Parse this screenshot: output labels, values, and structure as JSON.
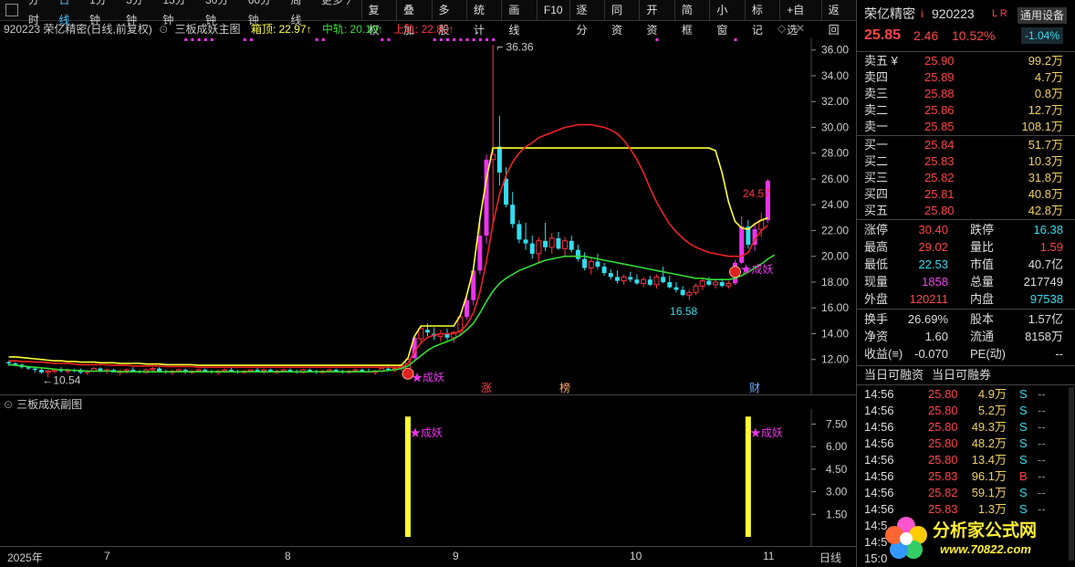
{
  "toolbar": {
    "periods": [
      "分时",
      "日线",
      "1分钟",
      "5分钟",
      "15分钟",
      "30分钟",
      "60分钟",
      "周线",
      "更多 〉"
    ],
    "active_period": "日线",
    "buttons": [
      "复权",
      "叠加",
      "多股",
      "统计",
      "画线",
      "F10",
      "逐分",
      "同资",
      "开资",
      "简框",
      "小窗",
      "标记",
      "+自选",
      "返回"
    ]
  },
  "header": {
    "code_name": "920223 荣亿精密(日线,前复权)",
    "indicator": "三板成妖主图",
    "top_label": "箱顶: 22.97↑",
    "mid_label": "中轨: 20.10↑",
    "up_label": "上轨: 22.80↑"
  },
  "chart_data": {
    "type": "candlestick",
    "title": "920223 荣亿精密(日线,前复权)",
    "y_ticks": [
      12.0,
      14.0,
      16.0,
      18.0,
      20.0,
      22.0,
      24.0,
      26.0,
      28.0,
      30.0,
      32.0,
      34.0,
      36.0
    ],
    "ylim": [
      10.0,
      36.9
    ],
    "x_labels": [
      "2025年",
      "7",
      "8",
      "9",
      "10",
      "11",
      "日线"
    ],
    "annotations": {
      "high": "36.36",
      "low_left": "←10.54",
      "low_mid": "16.58",
      "recent": "24.57",
      "signal": "★成妖"
    },
    "markers": [
      "涨",
      "榜",
      "财"
    ],
    "candles": [
      [
        11.8,
        11.9,
        11.5,
        11.7
      ],
      [
        11.7,
        11.8,
        11.5,
        11.6
      ],
      [
        11.6,
        11.7,
        11.3,
        11.4
      ],
      [
        11.4,
        11.5,
        11.2,
        11.3
      ],
      [
        11.3,
        11.4,
        11.0,
        11.2
      ],
      [
        11.2,
        11.3,
        10.9,
        11.0
      ],
      [
        11.0,
        11.2,
        10.6,
        11.1
      ],
      [
        11.1,
        11.3,
        10.9,
        11.2
      ],
      [
        11.2,
        11.4,
        11.0,
        11.1
      ],
      [
        11.1,
        11.3,
        10.9,
        11.2
      ],
      [
        11.2,
        11.3,
        11.0,
        11.1
      ],
      [
        11.1,
        11.3,
        10.9,
        11.0
      ],
      [
        11.0,
        11.2,
        10.8,
        11.1
      ],
      [
        11.1,
        11.4,
        11.0,
        11.3
      ],
      [
        11.3,
        11.4,
        11.0,
        11.1
      ],
      [
        11.1,
        11.3,
        10.9,
        11.2
      ],
      [
        11.2,
        11.3,
        11.0,
        11.0
      ],
      [
        11.0,
        11.2,
        10.8,
        11.1
      ],
      [
        11.1,
        11.3,
        10.9,
        11.2
      ],
      [
        11.2,
        11.4,
        11.0,
        11.1
      ],
      [
        11.1,
        11.2,
        10.9,
        11.0
      ],
      [
        11.0,
        11.3,
        10.9,
        11.2
      ],
      [
        11.2,
        11.4,
        11.0,
        11.3
      ],
      [
        11.3,
        11.4,
        11.1,
        11.1
      ],
      [
        11.1,
        11.2,
        10.9,
        11.0
      ],
      [
        11.0,
        11.2,
        10.8,
        11.1
      ],
      [
        11.1,
        11.3,
        11.0,
        11.2
      ],
      [
        11.2,
        11.3,
        10.9,
        11.0
      ],
      [
        11.0,
        11.2,
        10.9,
        11.1
      ],
      [
        11.1,
        11.3,
        11.0,
        11.2
      ],
      [
        11.2,
        11.3,
        11.0,
        11.1
      ],
      [
        11.1,
        11.2,
        10.9,
        11.0
      ],
      [
        11.0,
        11.2,
        10.8,
        11.1
      ],
      [
        11.1,
        11.3,
        11.0,
        11.2
      ],
      [
        11.2,
        11.4,
        11.0,
        11.1
      ],
      [
        11.1,
        11.2,
        10.9,
        11.0
      ],
      [
        11.0,
        11.2,
        10.9,
        11.1
      ],
      [
        11.1,
        11.2,
        11.0,
        11.2
      ],
      [
        11.2,
        11.4,
        11.0,
        11.1
      ],
      [
        11.1,
        11.3,
        10.9,
        11.2
      ],
      [
        11.2,
        11.3,
        11.0,
        11.0
      ],
      [
        11.0,
        11.2,
        10.9,
        11.1
      ],
      [
        11.1,
        11.3,
        11.0,
        11.2
      ],
      [
        11.2,
        11.3,
        11.0,
        11.1
      ],
      [
        11.1,
        11.2,
        10.9,
        11.0
      ],
      [
        11.0,
        11.3,
        10.9,
        11.2
      ],
      [
        11.2,
        11.3,
        11.0,
        11.1
      ],
      [
        11.1,
        11.2,
        10.9,
        11.0
      ],
      [
        11.0,
        11.2,
        10.9,
        11.1
      ],
      [
        11.1,
        11.3,
        11.0,
        11.2
      ],
      [
        11.2,
        11.3,
        11.0,
        11.1
      ],
      [
        11.1,
        11.2,
        10.9,
        11.0
      ],
      [
        11.0,
        11.2,
        10.9,
        11.1
      ],
      [
        11.1,
        11.3,
        11.0,
        11.2
      ],
      [
        11.2,
        11.3,
        11.0,
        11.1
      ],
      [
        11.1,
        11.3,
        11.0,
        11.0
      ],
      [
        11.0,
        11.2,
        10.8,
        11.1
      ],
      [
        11.1,
        11.3,
        11.0,
        11.3
      ],
      [
        11.3,
        11.5,
        11.1,
        11.2
      ],
      [
        11.2,
        11.4,
        11.0,
        11.3
      ],
      [
        11.3,
        11.6,
        11.1,
        11.5
      ],
      [
        11.0,
        12.2,
        10.9,
        12.0
      ],
      [
        12.1,
        13.8,
        12.0,
        13.7
      ],
      [
        13.6,
        14.6,
        13.3,
        14.4
      ],
      [
        14.3,
        14.8,
        13.8,
        14.1
      ],
      [
        14.0,
        14.5,
        13.5,
        13.8
      ],
      [
        13.8,
        14.3,
        13.4,
        14.0
      ],
      [
        14.0,
        14.4,
        13.5,
        13.7
      ],
      [
        13.7,
        14.2,
        13.3,
        14.1
      ],
      [
        14.2,
        15.4,
        14.0,
        15.3
      ],
      [
        15.3,
        17.0,
        15.1,
        16.6
      ],
      [
        16.6,
        19.0,
        16.2,
        18.9
      ],
      [
        18.9,
        22.9,
        18.6,
        21.6
      ],
      [
        21.6,
        27.9,
        21.0,
        27.5
      ],
      [
        27.5,
        36.4,
        22.5,
        27.9
      ],
      [
        28.5,
        30.9,
        25.5,
        26.5
      ],
      [
        26.0,
        26.9,
        23.8,
        24.0
      ],
      [
        24.0,
        25.0,
        22.2,
        22.5
      ],
      [
        22.5,
        22.8,
        21.0,
        21.3
      ],
      [
        21.3,
        22.6,
        20.5,
        21.0
      ],
      [
        21.0,
        21.6,
        19.8,
        20.2
      ],
      [
        20.2,
        21.5,
        19.5,
        21.2
      ],
      [
        21.2,
        22.6,
        20.4,
        20.7
      ],
      [
        20.7,
        21.8,
        20.2,
        21.4
      ],
      [
        21.4,
        21.9,
        20.5,
        20.6
      ],
      [
        20.6,
        21.5,
        20.0,
        21.2
      ],
      [
        21.2,
        21.6,
        20.3,
        20.5
      ],
      [
        20.5,
        20.9,
        19.6,
        19.8
      ],
      [
        19.8,
        20.3,
        18.9,
        19.1
      ],
      [
        19.1,
        19.9,
        18.6,
        19.6
      ],
      [
        19.6,
        20.2,
        19.0,
        19.2
      ],
      [
        19.2,
        19.5,
        18.5,
        18.7
      ],
      [
        18.7,
        19.0,
        18.2,
        18.4
      ],
      [
        18.4,
        18.9,
        17.9,
        18.1
      ],
      [
        18.1,
        18.6,
        17.8,
        18.4
      ],
      [
        18.4,
        18.8,
        18.0,
        18.2
      ],
      [
        18.2,
        18.6,
        17.8,
        17.9
      ],
      [
        17.9,
        18.4,
        17.6,
        18.2
      ],
      [
        18.2,
        18.5,
        17.7,
        17.8
      ],
      [
        17.8,
        18.6,
        17.5,
        18.4
      ],
      [
        18.4,
        19.2,
        17.9,
        18.0
      ],
      [
        18.0,
        18.5,
        17.5,
        17.6
      ],
      [
        17.6,
        18.0,
        17.2,
        17.4
      ],
      [
        17.4,
        17.7,
        16.9,
        17.0
      ],
      [
        17.0,
        17.4,
        16.6,
        17.2
      ],
      [
        17.2,
        17.9,
        17.0,
        17.7
      ],
      [
        17.7,
        18.3,
        17.4,
        18.1
      ],
      [
        18.1,
        18.4,
        17.7,
        17.8
      ],
      [
        17.8,
        18.2,
        17.5,
        18.0
      ],
      [
        18.0,
        18.3,
        17.6,
        17.7
      ],
      [
        17.7,
        18.1,
        17.5,
        17.9
      ],
      [
        17.9,
        19.7,
        17.8,
        19.5
      ],
      [
        19.5,
        23.1,
        19.4,
        22.3
      ],
      [
        22.3,
        22.8,
        20.6,
        20.9
      ],
      [
        20.9,
        22.6,
        20.4,
        22.1
      ],
      [
        22.1,
        23.4,
        21.5,
        22.8
      ],
      [
        22.8,
        26.0,
        22.6,
        25.85
      ]
    ],
    "ma_yellow": [
      12.2,
      12.2,
      12.15,
      12.1,
      12.05,
      12.0,
      11.95,
      11.9,
      11.9,
      11.85,
      11.85,
      11.8,
      11.8,
      11.8,
      11.75,
      11.75,
      11.75,
      11.7,
      11.7,
      11.7,
      11.7,
      11.65,
      11.65,
      11.65,
      11.6,
      11.6,
      11.6,
      11.6,
      11.6,
      11.55,
      11.55,
      11.55,
      11.55,
      11.55,
      11.55,
      11.55,
      11.55,
      11.55,
      11.55,
      11.55,
      11.55,
      11.55,
      11.55,
      11.55,
      11.55,
      11.55,
      11.55,
      11.55,
      11.55,
      11.55,
      11.55,
      11.55,
      11.55,
      11.55,
      11.55,
      11.55,
      11.55,
      11.55,
      11.55,
      11.55,
      11.55,
      12.1,
      13.8,
      14.6,
      14.6,
      14.6,
      14.6,
      14.6,
      14.6,
      15.4,
      17.0,
      19.0,
      22.9,
      26.0,
      28.4,
      28.4,
      28.4,
      28.4,
      28.4,
      28.4,
      28.4,
      28.4,
      28.4,
      28.4,
      28.4,
      28.4,
      28.4,
      28.4,
      28.4,
      28.4,
      28.4,
      28.4,
      28.4,
      28.4,
      28.4,
      28.4,
      28.4,
      28.4,
      28.4,
      28.4,
      28.4,
      28.4,
      28.4,
      28.4,
      28.4,
      28.4,
      28.4,
      28.4,
      28.2,
      26.5,
      24.2,
      22.7,
      22.2,
      22.1,
      22.5,
      22.8,
      23.0
    ],
    "ma_red": [
      11.9,
      11.9,
      11.85,
      11.85,
      11.8,
      11.8,
      11.75,
      11.7,
      11.7,
      11.7,
      11.65,
      11.6,
      11.6,
      11.6,
      11.6,
      11.6,
      11.55,
      11.55,
      11.55,
      11.5,
      11.5,
      11.5,
      11.5,
      11.5,
      11.45,
      11.45,
      11.45,
      11.45,
      11.45,
      11.4,
      11.4,
      11.4,
      11.4,
      11.4,
      11.4,
      11.4,
      11.4,
      11.4,
      11.4,
      11.4,
      11.4,
      11.4,
      11.4,
      11.4,
      11.4,
      11.4,
      11.4,
      11.4,
      11.4,
      11.4,
      11.4,
      11.4,
      11.4,
      11.4,
      11.4,
      11.4,
      11.4,
      11.4,
      11.4,
      11.4,
      11.4,
      11.7,
      12.6,
      13.3,
      13.7,
      13.9,
      14.0,
      14.0,
      14.0,
      14.2,
      14.7,
      15.6,
      17.2,
      19.6,
      22.5,
      24.8,
      26.3,
      27.3,
      28.0,
      28.5,
      28.8,
      29.2,
      29.4,
      29.6,
      29.8,
      30.0,
      30.1,
      30.2,
      30.2,
      30.2,
      30.1,
      30.0,
      29.8,
      29.5,
      29.0,
      28.3,
      27.5,
      26.5,
      25.3,
      24.2,
      23.3,
      22.5,
      21.9,
      21.4,
      21.0,
      20.7,
      20.5,
      20.3,
      20.2,
      20.1,
      20.0,
      20.0,
      20.0,
      20.3,
      21.3,
      22.0,
      22.4
    ],
    "ma_green": [
      11.6,
      11.55,
      11.5,
      11.45,
      11.4,
      11.35,
      11.3,
      11.25,
      11.2,
      11.2,
      11.15,
      11.15,
      11.1,
      11.1,
      11.1,
      11.1,
      11.1,
      11.05,
      11.05,
      11.05,
      11.05,
      11.05,
      11.05,
      11.05,
      11.05,
      11.05,
      11.05,
      11.05,
      11.05,
      11.05,
      11.05,
      11.05,
      11.05,
      11.05,
      11.05,
      11.05,
      11.05,
      11.05,
      11.05,
      11.05,
      11.05,
      11.05,
      11.05,
      11.05,
      11.05,
      11.05,
      11.05,
      11.05,
      11.05,
      11.05,
      11.05,
      11.05,
      11.05,
      11.05,
      11.05,
      11.05,
      11.1,
      11.1,
      11.15,
      11.2,
      11.3,
      11.5,
      11.9,
      12.3,
      12.7,
      13.0,
      13.2,
      13.4,
      13.6,
      13.9,
      14.3,
      14.8,
      15.6,
      16.5,
      17.3,
      17.9,
      18.3,
      18.6,
      18.9,
      19.1,
      19.3,
      19.5,
      19.7,
      19.8,
      19.9,
      20.0,
      20.0,
      20.0,
      20.0,
      19.9,
      19.8,
      19.7,
      19.6,
      19.5,
      19.4,
      19.3,
      19.2,
      19.1,
      19.0,
      18.9,
      18.8,
      18.7,
      18.6,
      18.5,
      18.4,
      18.3,
      18.3,
      18.2,
      18.2,
      18.2,
      18.2,
      18.3,
      18.5,
      18.8,
      19.1,
      19.4,
      19.8,
      20.1
    ],
    "sub_ticks": [
      1.5,
      3.0,
      4.5,
      6.0,
      7.5
    ],
    "sub_ylim": [
      0,
      8.5
    ],
    "sub_bars": [
      {
        "index": 61,
        "value": 8.0
      },
      {
        "index": 113,
        "value": 8.0
      }
    ]
  },
  "sub": {
    "title": "三板成妖副图",
    "signal": "★成妖"
  },
  "quote": {
    "name": "荣亿精密",
    "mark": "i",
    "code": "920223",
    "badges": "L R",
    "device": "通用设备",
    "price": "25.85",
    "change": "2.46",
    "pct": "10.52%",
    "extra": "-1.04%",
    "asks": [
      {
        "label": "卖五 ¥",
        "price": "25.90",
        "vol": "99.2万"
      },
      {
        "label": "卖四",
        "price": "25.89",
        "vol": "4.7万"
      },
      {
        "label": "卖三",
        "price": "25.88",
        "vol": "0.8万"
      },
      {
        "label": "卖二",
        "price": "25.86",
        "vol": "12.7万"
      },
      {
        "label": "卖一",
        "price": "25.85",
        "vol": "108.1万"
      }
    ],
    "bids": [
      {
        "label": "买一",
        "price": "25.84",
        "vol": "51.7万"
      },
      {
        "label": "买二",
        "price": "25.83",
        "vol": "10.3万"
      },
      {
        "label": "买三",
        "price": "25.82",
        "vol": "31.8万"
      },
      {
        "label": "买四",
        "price": "25.81",
        "vol": "40.8万"
      },
      {
        "label": "买五",
        "price": "25.80",
        "vol": "42.8万"
      }
    ],
    "stats": [
      {
        "l1": "涨停",
        "v1": "30.40",
        "c1": "red",
        "l2": "跌停",
        "v2": "16.38",
        "c2": "cyan"
      },
      {
        "l1": "最高",
        "v1": "29.02",
        "c1": "red",
        "l2": "量比",
        "v2": "1.59",
        "c2": "red"
      },
      {
        "l1": "最低",
        "v1": "22.53",
        "c1": "cyan",
        "l2": "市值",
        "v2": "40.7亿",
        "c2": "white"
      },
      {
        "l1": "现量",
        "v1": "1858",
        "c1": "mag",
        "l2": "总量",
        "v2": "217749",
        "c2": "white"
      },
      {
        "l1": "外盘",
        "v1": "120211",
        "c1": "red",
        "l2": "内盘",
        "v2": "97538",
        "c2": "cyan"
      }
    ],
    "fund": [
      {
        "l1": "换手",
        "v1": "26.69%",
        "l2": "股本",
        "v2": "1.57亿"
      },
      {
        "l1": "净资",
        "v1": "1.60",
        "l2": "流通",
        "v2": "8158万"
      },
      {
        "l1": "收益(≡)",
        "v1": "-0.070",
        "l2": "PE(动)",
        "v2": "--"
      }
    ],
    "tabs": [
      "当日可融资",
      "当日可融券"
    ],
    "ticks": [
      {
        "t": "14:56",
        "p": "25.80",
        "v": "4.9万",
        "s": "S"
      },
      {
        "t": "14:56",
        "p": "25.80",
        "v": "5.2万",
        "s": "S"
      },
      {
        "t": "14:56",
        "p": "25.80",
        "v": "49.3万",
        "s": "S"
      },
      {
        "t": "14:56",
        "p": "25.80",
        "v": "48.2万",
        "s": "S"
      },
      {
        "t": "14:56",
        "p": "25.80",
        "v": "13.4万",
        "s": "S"
      },
      {
        "t": "14:56",
        "p": "25.83",
        "v": "96.1万",
        "s": "B"
      },
      {
        "t": "14:56",
        "p": "25.82",
        "v": "59.1万",
        "s": "S"
      },
      {
        "t": "14:56",
        "p": "25.83",
        "v": "1.3万",
        "s": "S"
      },
      {
        "t": "14:5",
        "p": "",
        "v": "",
        "s": ""
      },
      {
        "t": "14:5",
        "p": "",
        "v": "",
        "s": ""
      },
      {
        "t": "15:0",
        "p": "",
        "v": "",
        "s": ""
      }
    ],
    "dash": "--"
  },
  "watermark": {
    "name": "分析家公式网",
    "url": "www.70822.com"
  },
  "colors": {
    "up": "#ff3344",
    "down": "#33ddee",
    "yellow": "#ffff33",
    "red": "#ee2222",
    "green": "#33dd33",
    "magenta": "#ee33ee"
  }
}
